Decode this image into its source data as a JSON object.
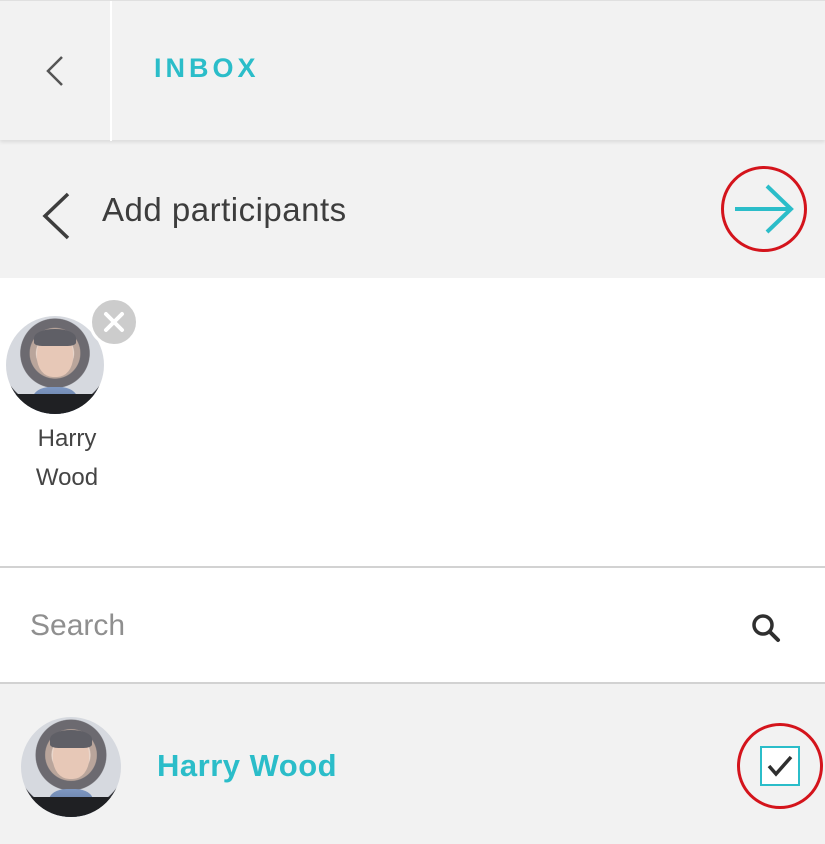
{
  "header": {
    "title": "INBOX",
    "back_icon": "chevron-left-icon"
  },
  "sub_header": {
    "title": "Add participants",
    "back_icon": "chevron-left-icon",
    "next_icon": "arrow-right-icon"
  },
  "selected_participants": [
    {
      "first_name": "Harry",
      "last_name": "Wood",
      "remove_icon": "close-icon"
    }
  ],
  "search": {
    "placeholder": "Search",
    "value": "",
    "icon": "search-icon"
  },
  "contacts": [
    {
      "name": "Harry Wood",
      "checked": true
    }
  ],
  "colors": {
    "accent": "#2bbdc9",
    "highlight_ring": "#d4141c",
    "header_bg": "#f2f2f2",
    "text_dark": "#3d3d3d"
  }
}
